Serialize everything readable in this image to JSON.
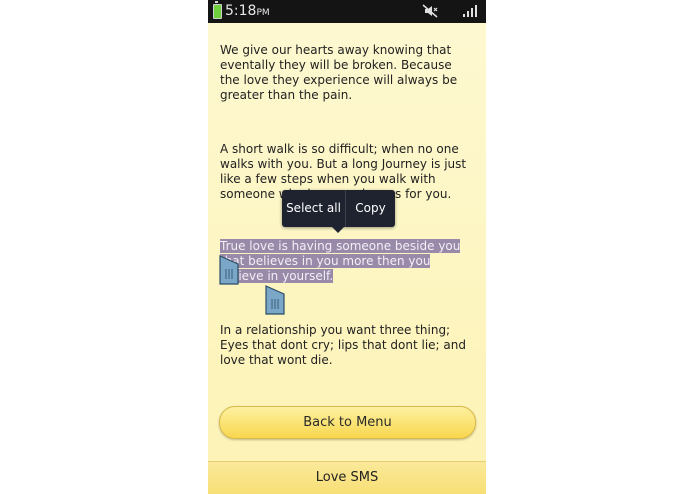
{
  "status_bar": {
    "time": "5:18",
    "ampm": "PM",
    "icons": [
      "battery-icon",
      "mute-icon",
      "signal-icon"
    ]
  },
  "messages": [
    "We give our hearts away knowing that eventally they will be broken. Because the love they experience will always be greater than the pain.",
    "A short walk is so difficult; when no one walks with you. But a long Journey is just like a few steps when you walk with someone who loves and cares for you.",
    "True love is having someone beside you that believes in you more then you believe in yourself.",
    "In a relationship you want three thing; Eyes that dont cry; lips that dont lie; and love that wont die."
  ],
  "selection_popup": {
    "select_all": "Select all",
    "copy": "Copy"
  },
  "back_button": "Back to Menu",
  "bottom_bar": {
    "title": "Love SMS"
  },
  "colors": {
    "background": "#fdf6c4",
    "selection": "#9a8aa9",
    "popup": "#1f2330",
    "button": "#f8d74e"
  }
}
